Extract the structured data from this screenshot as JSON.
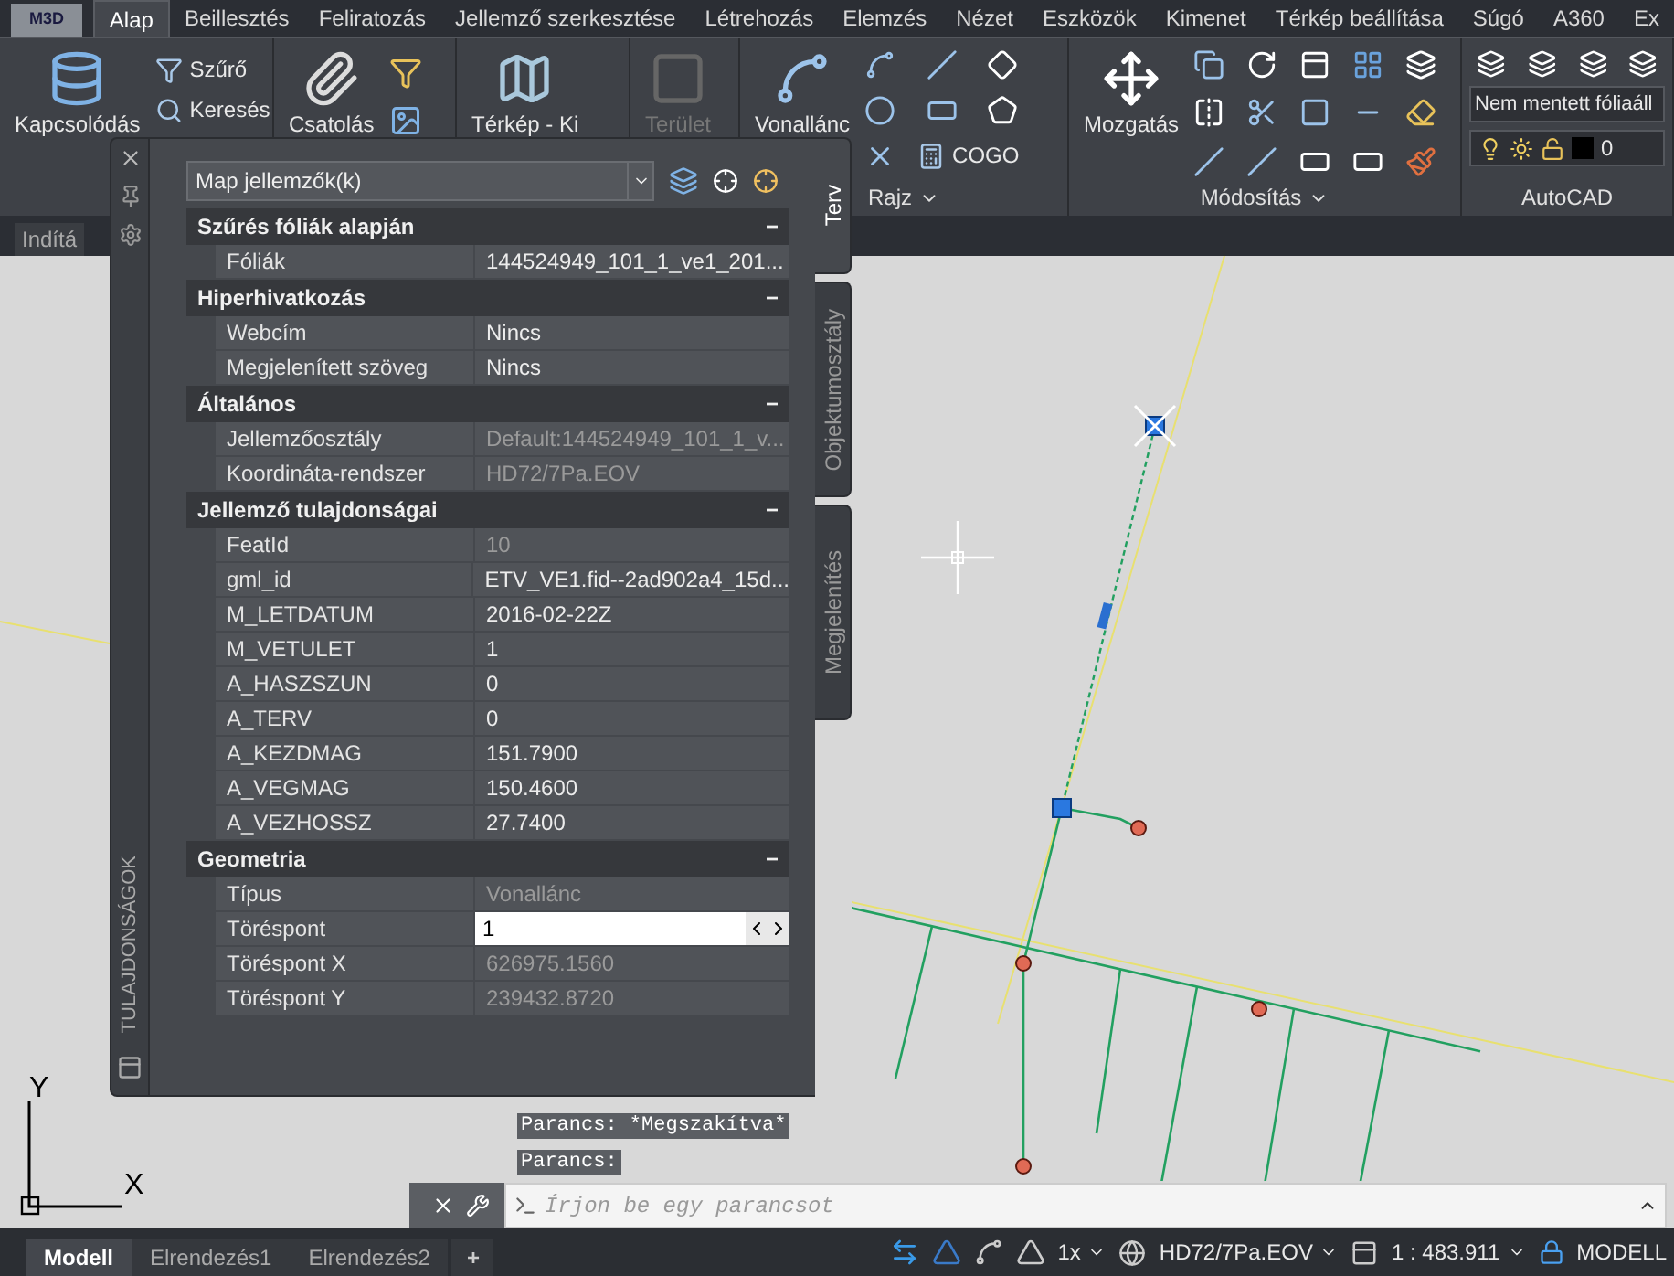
{
  "menu": {
    "app_button": "M3D",
    "tabs": [
      {
        "label": "Alap",
        "selected": true
      },
      {
        "label": "Beillesztés",
        "selected": false
      },
      {
        "label": "Feliratozás",
        "selected": false
      },
      {
        "label": "Jellemző szerkesztése",
        "selected": false
      },
      {
        "label": "Létrehozás",
        "selected": false
      },
      {
        "label": "Elemzés",
        "selected": false
      },
      {
        "label": "Nézet",
        "selected": false
      },
      {
        "label": "Eszközök",
        "selected": false
      },
      {
        "label": "Kimenet",
        "selected": false
      },
      {
        "label": "Térkép beállítása",
        "selected": false
      },
      {
        "label": "Súgó",
        "selected": false
      },
      {
        "label": "A360",
        "selected": false
      },
      {
        "label": "Ex",
        "selected": false
      }
    ]
  },
  "ribbon": {
    "groups": [
      {
        "buttons": [
          {
            "label": "Kapcsolódás",
            "kind": "large",
            "disabled": false
          },
          {
            "label": "Szűrő",
            "kind": "small",
            "disabled": false
          },
          {
            "label": "Keresés",
            "kind": "small",
            "disabled": false
          }
        ]
      },
      {
        "buttons": [
          {
            "label": "Csatolás",
            "kind": "large",
            "disabled": false
          }
        ]
      },
      {
        "buttons": [
          {
            "label": "Térkép - Ki",
            "kind": "large",
            "disabled": false
          }
        ]
      },
      {
        "buttons": [
          {
            "label": "Terület",
            "kind": "large",
            "disabled": true
          }
        ]
      },
      {
        "title": "Rajz",
        "menu": true,
        "buttons": [
          {
            "label": "Vonallánc",
            "kind": "large",
            "disabled": false
          },
          {
            "label": "COGO",
            "kind": "small",
            "disabled": false
          }
        ]
      },
      {
        "title": "Módosítás",
        "menu": true,
        "buttons": [
          {
            "label": "Mozgatás",
            "kind": "large",
            "disabled": false
          }
        ]
      },
      {
        "title": "AutoCAD",
        "menu": false,
        "layer_state": "Nem mentett fóliaáll",
        "layer": "0"
      }
    ]
  },
  "file_tabs": [
    {
      "label": "Indítá",
      "selected": false
    }
  ],
  "palette": {
    "side_title": "TULAJDONSÁGOK",
    "selector": "Map jellemzők(k)",
    "sections": [
      {
        "title": "Szűrés fóliák alapján",
        "toggle": "−",
        "expanded": true,
        "rows": [
          {
            "label": "Fóliák",
            "value": "144524949_101_1_ve1_201...",
            "readonly": false,
            "kind": "text"
          }
        ]
      },
      {
        "title": "Hiperhivatkozás",
        "toggle": "−",
        "expanded": true,
        "rows": [
          {
            "label": "Webcím",
            "value": "Nincs",
            "readonly": false,
            "kind": "text"
          },
          {
            "label": "Megjelenített szöveg",
            "value": "Nincs",
            "readonly": false,
            "kind": "text"
          }
        ]
      },
      {
        "title": "Általános",
        "toggle": "−",
        "expanded": true,
        "rows": [
          {
            "label": "Jellemzőosztály",
            "value": "Default:144524949_101_1_v...",
            "readonly": true,
            "kind": "text"
          },
          {
            "label": "Koordináta-rendszer",
            "value": "HD72/7Pa.EOV",
            "readonly": true,
            "kind": "text"
          }
        ]
      },
      {
        "title": "Jellemző tulajdonságai",
        "toggle": "−",
        "expanded": true,
        "rows": [
          {
            "label": "FeatId",
            "value": "10",
            "readonly": true,
            "kind": "text"
          },
          {
            "label": "gml_id",
            "value": "ETV_VE1.fid--2ad902a4_15d...",
            "readonly": false,
            "kind": "text"
          },
          {
            "label": "M_LETDATUM",
            "value": "2016-02-22Z",
            "readonly": false,
            "kind": "text"
          },
          {
            "label": "M_VETULET",
            "value": "1",
            "readonly": false,
            "kind": "text"
          },
          {
            "label": "A_HASZSZUN",
            "value": "0",
            "readonly": false,
            "kind": "text"
          },
          {
            "label": "A_TERV",
            "value": "0",
            "readonly": false,
            "kind": "text"
          },
          {
            "label": "A_KEZDMAG",
            "value": "151.7900",
            "readonly": false,
            "kind": "text"
          },
          {
            "label": "A_VEGMAG",
            "value": "150.4600",
            "readonly": false,
            "kind": "text"
          },
          {
            "label": "A_VEZHOSSZ",
            "value": "27.7400",
            "readonly": false,
            "kind": "text"
          }
        ]
      },
      {
        "title": "Geometria",
        "toggle": "−",
        "expanded": true,
        "rows": [
          {
            "label": "Típus",
            "value": "Vonallánc",
            "readonly": true,
            "kind": "text"
          },
          {
            "label": "Töréspont",
            "value": "1",
            "readonly": false,
            "kind": "spinner"
          },
          {
            "label": "Töréspont X",
            "value": "626975.1560",
            "readonly": true,
            "kind": "text"
          },
          {
            "label": "Töréspont Y",
            "value": "239432.8720",
            "readonly": true,
            "kind": "text"
          }
        ]
      }
    ],
    "tabs": [
      {
        "label": "Terv",
        "selected": true
      },
      {
        "label": "Objektumosztály",
        "selected": false
      },
      {
        "label": "Megjelenítés",
        "selected": false
      }
    ]
  },
  "ucs": {
    "x_label": "X",
    "y_label": "Y"
  },
  "command_line": {
    "history": [
      "Parancs: *Megszakítva*",
      "Parancs:"
    ],
    "placeholder": "Írjon be egy parancsot"
  },
  "status_bar": {
    "layout_tabs": [
      {
        "label": "Modell",
        "selected": true
      },
      {
        "label": "Elrendezés1",
        "selected": false
      },
      {
        "label": "Elrendezés2",
        "selected": false
      }
    ],
    "add_tab": "+",
    "annotation_scale": "1x",
    "coordinate_system": "HD72/7Pa.EOV",
    "scale": "1 : 483.911",
    "space": "MODELL"
  }
}
